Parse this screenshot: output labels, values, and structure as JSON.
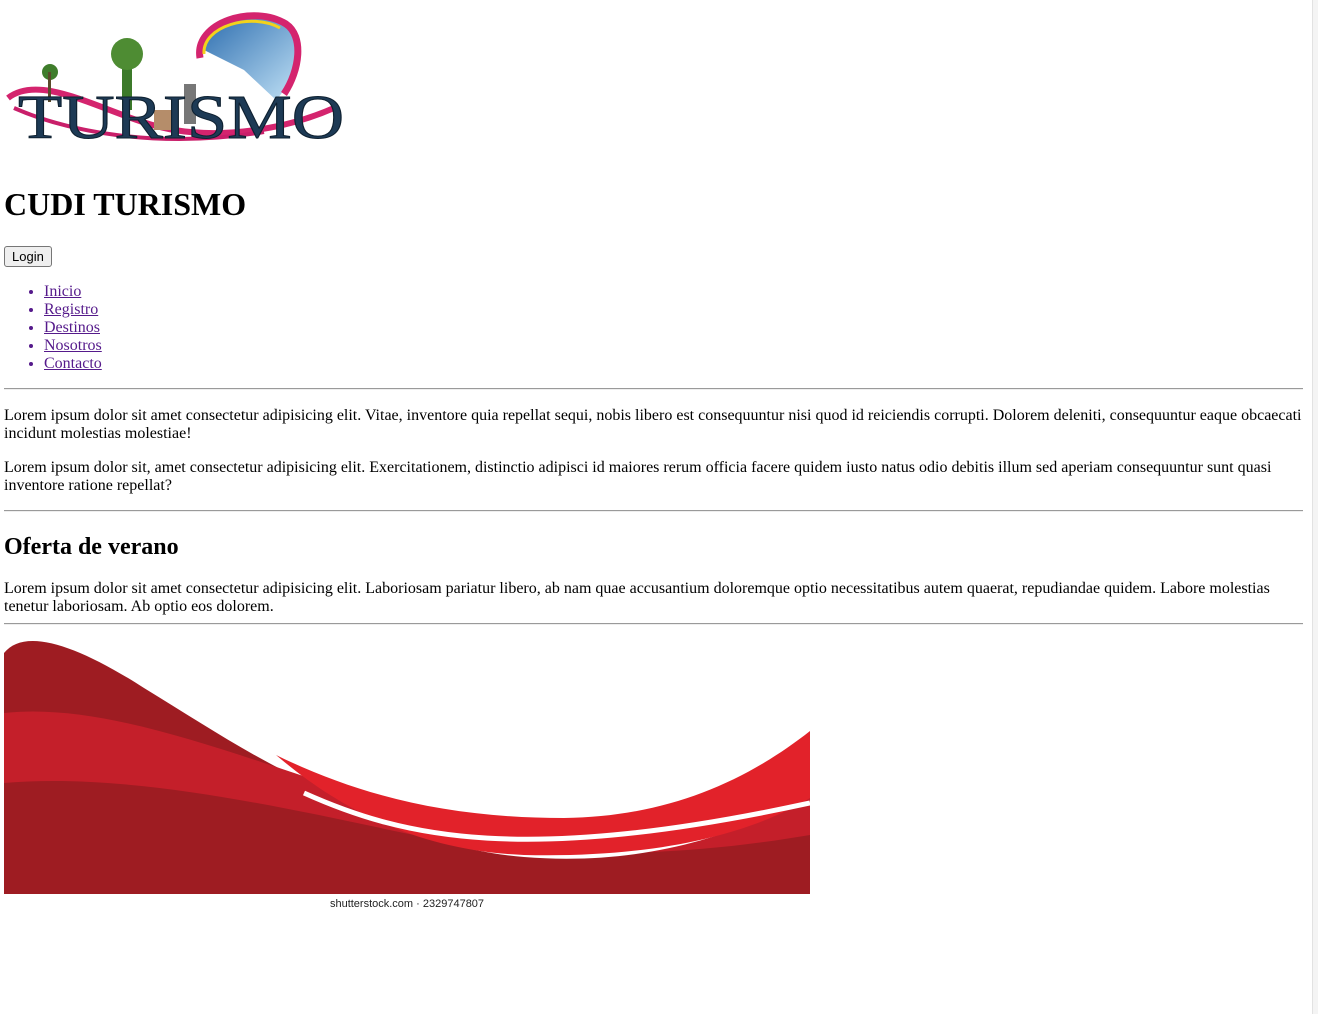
{
  "logo": {
    "text": "TURISMO"
  },
  "site_title": "CUDI TURISMO",
  "login_button": "Login",
  "nav": {
    "items": [
      {
        "label": "Inicio"
      },
      {
        "label": "Registro"
      },
      {
        "label": "Destinos"
      },
      {
        "label": "Nosotros"
      },
      {
        "label": "Contacto"
      }
    ]
  },
  "intro": {
    "paragraph1": "Lorem ipsum dolor sit amet consectetur adipisicing elit. Vitae, inventore quia repellat sequi, nobis libero est consequuntur nisi quod id reiciendis corrupti. Dolorem deleniti, consequuntur eaque obcaecati incidunt molestias molestiae!",
    "paragraph2": "Lorem ipsum dolor sit, amet consectetur adipisicing elit. Exercitationem, distinctio adipisci id maiores rerum officia facere quidem iusto natus odio debitis illum sed aperiam consequuntur sunt quasi inventore ratione repellat?"
  },
  "offer": {
    "title": "Oferta de verano",
    "paragraph": "Lorem ipsum dolor sit amet consectetur adipisicing elit. Laboriosam pariatur libero, ab nam quae accusantium doloremque optio necessitatibus autem quaerat, repudiandae quidem. Labore molestias tenetur laboriosam. Ab optio eos dolorem."
  },
  "banner": {
    "credit": "shutterstock.com · 2329747807"
  },
  "colors": {
    "link_visited": "#551a8b",
    "wave_dark": "#9e1c22",
    "wave_mid": "#c41f2a",
    "wave_bright": "#e2222a",
    "logo_pink": "#d4246e",
    "logo_navy": "#1d3a55"
  }
}
